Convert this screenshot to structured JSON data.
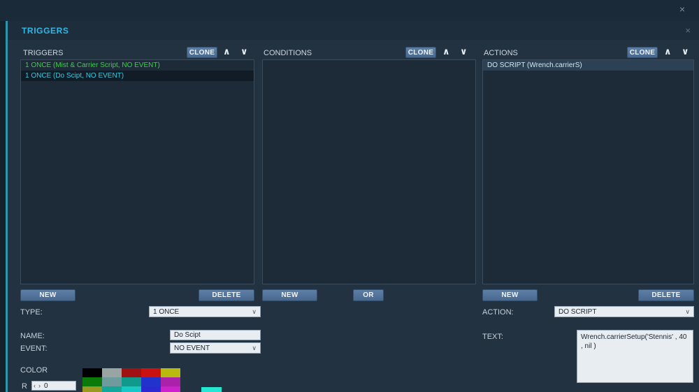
{
  "window": {
    "close_icon": "×"
  },
  "panel": {
    "title": "TRIGGERS",
    "close_icon": "×"
  },
  "icons": {
    "chevron_up": "∧",
    "chevron_down": "∨",
    "select_arrow": "∨",
    "spinner_left": "‹",
    "spinner_right": "›"
  },
  "columns": {
    "triggers": {
      "header": "TRIGGERS",
      "clone_label": "CLONE",
      "items": [
        {
          "label": "1 ONCE (Mist & Carrier Script, NO EVENT)",
          "color": "#41cd4d",
          "selected": false
        },
        {
          "label": "1 ONCE (Do Scipt, NO EVENT)",
          "color": "#38cbe0",
          "selected": true,
          "selected_bg": "#111c26"
        }
      ],
      "new_label": "NEW",
      "delete_label": "DELETE"
    },
    "conditions": {
      "header": "CONDITIONS",
      "clone_label": "CLONE",
      "items": [],
      "new_label": "NEW",
      "or_label": "OR"
    },
    "actions": {
      "header": "ACTIONS",
      "clone_label": "CLONE",
      "items": [
        {
          "label": "DO SCRIPT (Wrench.carrierS)",
          "color": "#d3e8f4",
          "selected": true,
          "selected_bg": "#2c4153"
        }
      ],
      "new_label": "NEW",
      "delete_label": "DELETE"
    }
  },
  "form": {
    "type_label": "TYPE:",
    "type_value": "1 ONCE",
    "name_label": "NAME:",
    "name_value": "Do Scipt",
    "event_label": "EVENT:",
    "event_value": "NO EVENT",
    "color_label": "COLOR",
    "r_label": "R",
    "r_value": "0",
    "action_label": "ACTION:",
    "action_value": "DO SCRIPT",
    "text_label": "TEXT:",
    "text_value": "Wrench.carrierSetup('Stennis' , 40\n, nil )"
  },
  "palette": {
    "rows": [
      [
        "#000000",
        "#98a5a3",
        "#a01212",
        "#cc1111",
        "#b8ba10"
      ],
      [
        "#0b7a0b",
        "#6e9c9c",
        "#0f9a8c",
        "#2233cc",
        "#aa22aa"
      ],
      [
        "#9a9a20",
        "#12a79a",
        "#19c7c7",
        "#2a2ad0",
        "#cc22cc"
      ]
    ],
    "selected_color": "#25e6d2"
  },
  "theme": {
    "accent_cyan": "#2bb9e7",
    "panel_bg": "#233240",
    "list_bg": "#1d2b38",
    "button_bg": "#53749c"
  }
}
